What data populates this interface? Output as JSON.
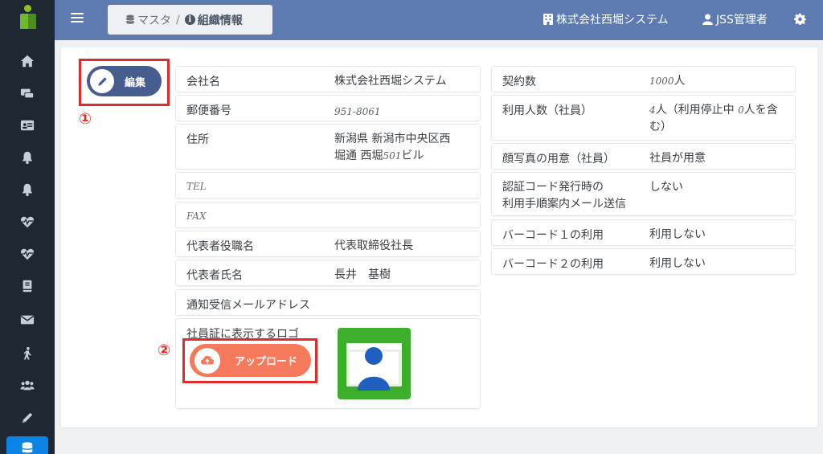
{
  "sidebar": {
    "icons": [
      "home-icon",
      "hardware-icon",
      "id-card-icon",
      "bell-icon",
      "bell-icon-2",
      "heartbeat-icon",
      "heartbeat-icon-2",
      "book-icon",
      "envelope-icon",
      "walking-icon",
      "users-icon",
      "pencil-icon",
      "database-icon"
    ],
    "active": "database-icon"
  },
  "header": {
    "breadcrumb": {
      "root": "マスタ",
      "separator": "/",
      "current": "組織情報"
    },
    "company": "株式会社西堀システム",
    "user": "JSS管理者"
  },
  "actions": {
    "edit_label": "編集",
    "upload_label": "アップロード"
  },
  "markers": {
    "one": "①",
    "two": "②"
  },
  "left": {
    "company_name": {
      "label": "会社名",
      "value": "株式会社西堀システム"
    },
    "postal": {
      "label": "郵便番号",
      "value": "951-8061"
    },
    "address": {
      "label": "住所",
      "line1": "新潟県 新潟市中央区西",
      "line2_pre": "堀通 西堀",
      "line2_num": "501",
      "line2_post": "ビル"
    },
    "tel": {
      "label": "TEL"
    },
    "fax": {
      "label": "FAX"
    },
    "rep_title": {
      "label": "代表者役職名",
      "value": "代表取締役社長"
    },
    "rep_name": {
      "label": "代表者氏名",
      "value": "長井　基樹"
    },
    "notify_email": {
      "label": "通知受信メールアドレス"
    },
    "logo": {
      "label": "社員証に表示するロゴ"
    }
  },
  "right": {
    "contracts": {
      "label": "契約数",
      "value_num": "1000",
      "value_unit": "人"
    },
    "users": {
      "label": "利用人数（社員）",
      "num1": "4",
      "text1": "人（利用停止中 ",
      "num2": "0",
      "text2": "人を含",
      "line2": "む）"
    },
    "photo": {
      "label": "顔写真の用意（社員）",
      "value": "社員が用意"
    },
    "auth": {
      "label_line1": "認証コード発行時の",
      "label_line2": "利用手順案内メール送信",
      "value": "しない"
    },
    "barcode1": {
      "label": "バーコード１の利用",
      "value": "利用しない"
    },
    "barcode2": {
      "label": "バーコード２の利用",
      "value": "利用しない"
    }
  },
  "colors": {
    "topbar": "#5d7bb0",
    "sidebar": "#1f2733",
    "edit_button": "#485d8f",
    "upload_button": "#f47a5b",
    "highlight": "#e02b2b",
    "logo_bg": "#3dae2b"
  }
}
